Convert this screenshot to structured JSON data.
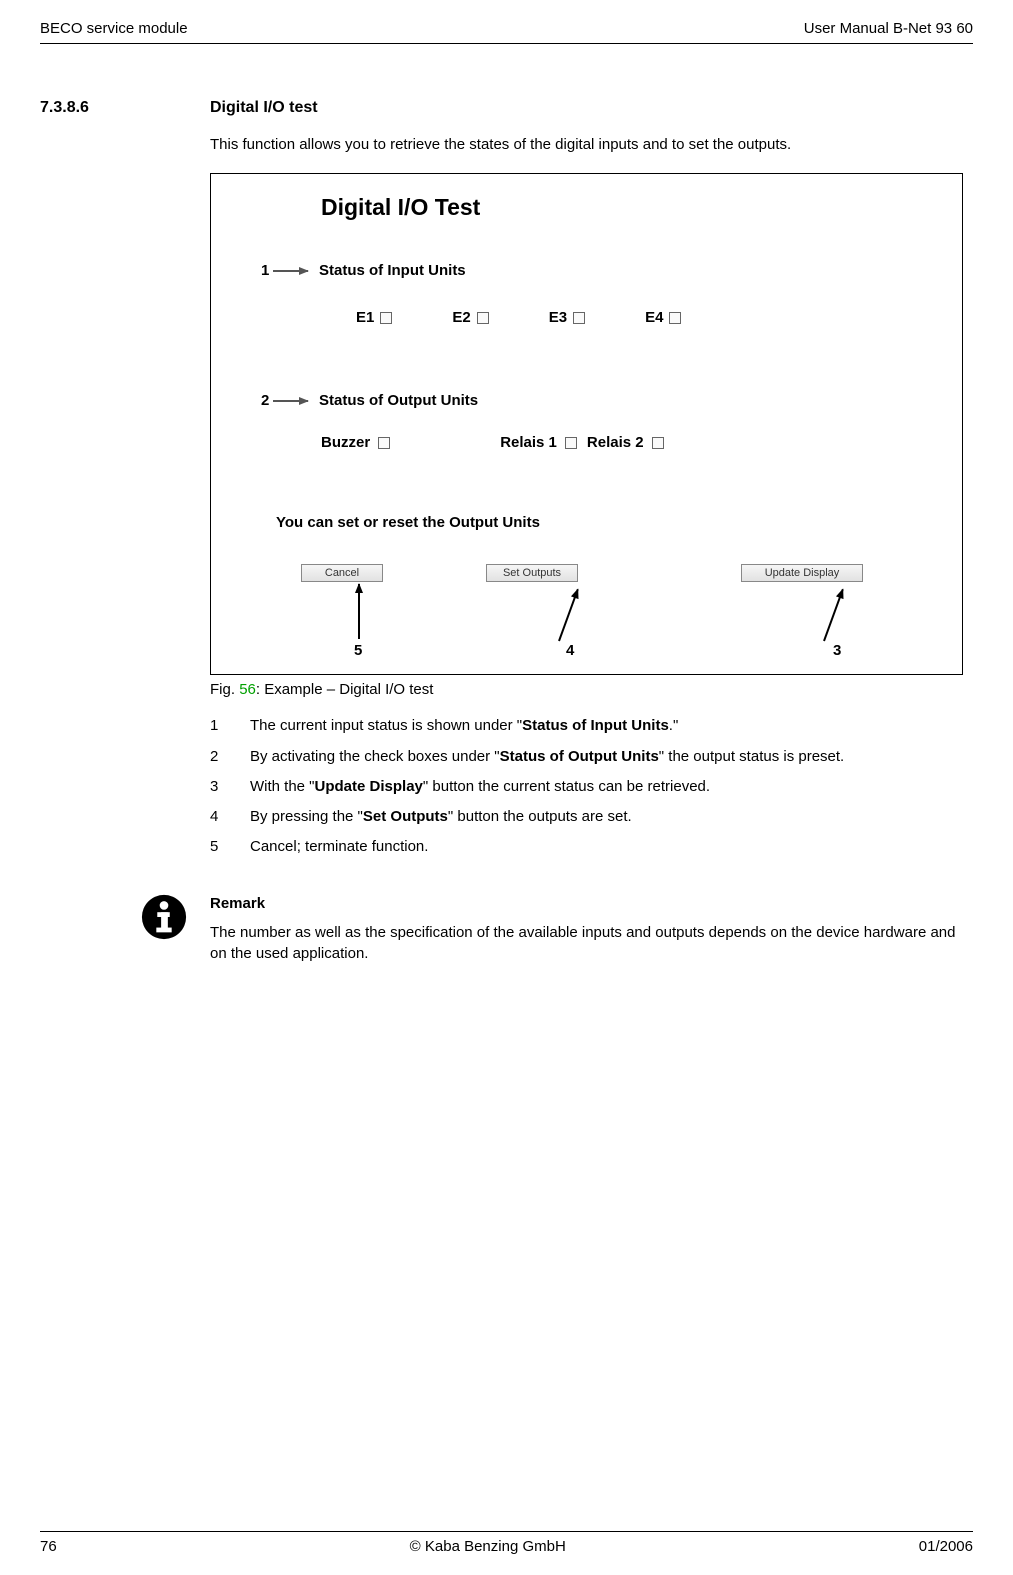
{
  "header": {
    "left": "BECO service module",
    "right": "User Manual B-Net 93 60"
  },
  "section": {
    "number": "7.3.8.6",
    "title": "Digital I/O test"
  },
  "intro": "This function allows you to retrieve the states of the digital inputs and to set the outputs.",
  "figure": {
    "title": "Digital I/O Test",
    "inputs_label": "Status of Input Units",
    "inputs": [
      "E1",
      "E2",
      "E3",
      "E4"
    ],
    "outputs_label": "Status of Output Units",
    "outputs": [
      "Buzzer",
      "Relais 1",
      "Relais 2"
    ],
    "set_hint": "You can set or reset the Output Units",
    "buttons": {
      "cancel": "Cancel",
      "set": "Set Outputs",
      "update": "Update Display"
    },
    "callouts": {
      "c1": "1",
      "c2": "2",
      "c3": "3",
      "c4": "4",
      "c5": "5"
    }
  },
  "caption": {
    "prefix": "Fig. ",
    "num": "56",
    "suffix": ": Example – Digital I/O test"
  },
  "list": {
    "i1_a": "The current input status is shown under \"",
    "i1_b": "Status of Input Units",
    "i1_c": ".\"",
    "i2_a": "By activating the check boxes under \"",
    "i2_b": "Status of Output Units",
    "i2_c": "\" the output status is preset.",
    "i3_a": "With the \"",
    "i3_b": "Update Display",
    "i3_c": "\" button the current status can be retrieved.",
    "i4_a": "By pressing the \"",
    "i4_b": "Set Outputs",
    "i4_c": "\" button the outputs are set.",
    "i5": "Cancel; terminate function."
  },
  "remark": {
    "heading": "Remark",
    "body": "The number as well as the specification of the available inputs and outputs depends on the device hardware and on the used application."
  },
  "footer": {
    "left": "76",
    "center": "© Kaba Benzing GmbH",
    "right": "01/2006"
  }
}
